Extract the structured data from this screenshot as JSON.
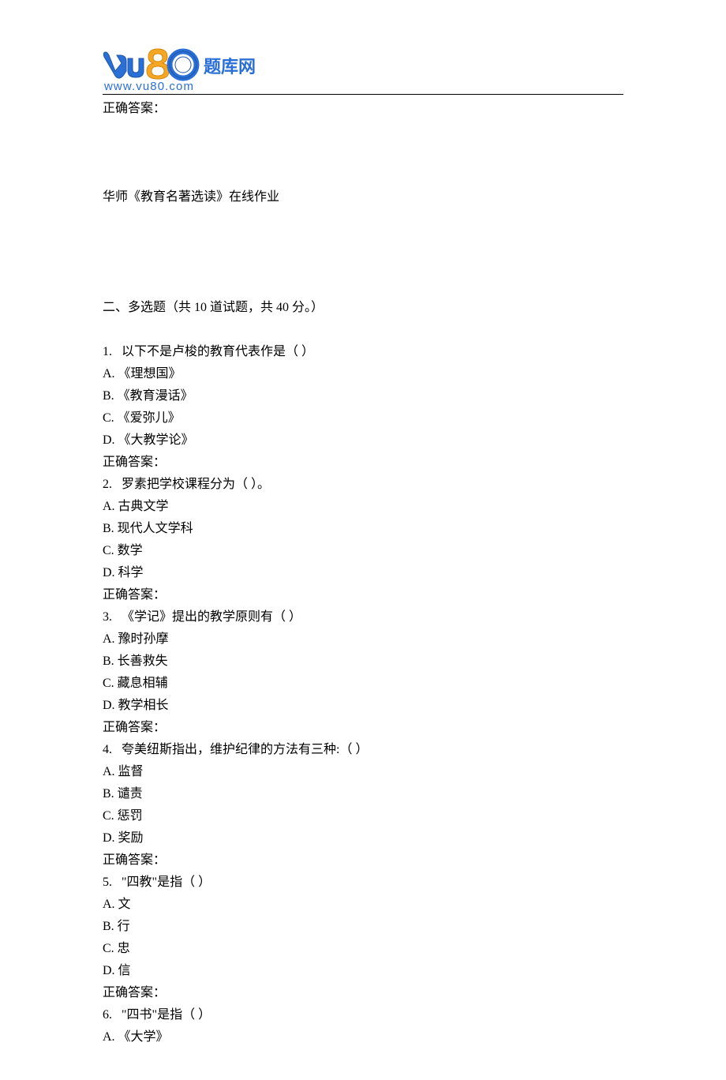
{
  "logo": {
    "brand_text": "题库网",
    "url_text": "www.vu80.com"
  },
  "intro": {
    "correct_answer_label": "正确答案：",
    "source_title": "华师《教育名著选读》在线作业"
  },
  "section": {
    "heading": "二、多选题（共 10 道试题，共 40 分。）"
  },
  "questions": [
    {
      "stem": "1.   以下不是卢梭的教育代表作是（ ）",
      "options": [
        "A. 《理想国》",
        "B. 《教育漫话》",
        "C. 《爱弥儿》",
        "D. 《大教学论》"
      ],
      "answer_label": "正确答案："
    },
    {
      "stem": "2.   罗素把学校课程分为（ ）。",
      "options": [
        "A. 古典文学",
        "B. 现代人文学科",
        "C. 数学",
        "D. 科学"
      ],
      "answer_label": "正确答案："
    },
    {
      "stem": "3.   《学记》提出的教学原则有（ ）",
      "options": [
        "A. 豫时孙摩",
        "B. 长善救失",
        "C. 藏息相辅",
        "D. 教学相长"
      ],
      "answer_label": "正确答案："
    },
    {
      "stem": "4.   夸美纽斯指出，维护纪律的方法有三种:（ ）",
      "options": [
        "A. 监督",
        "B. 谴责",
        "C. 惩罚",
        "D. 奖励"
      ],
      "answer_label": "正确答案："
    },
    {
      "stem": "5.   \"四教\"是指（ ）",
      "options": [
        "A. 文",
        "B. 行",
        "C. 忠",
        "D. 信"
      ],
      "answer_label": "正确答案："
    },
    {
      "stem": "6.   \"四书\"是指（ ）",
      "options": [
        "A. 《大学》"
      ],
      "answer_label": ""
    }
  ]
}
